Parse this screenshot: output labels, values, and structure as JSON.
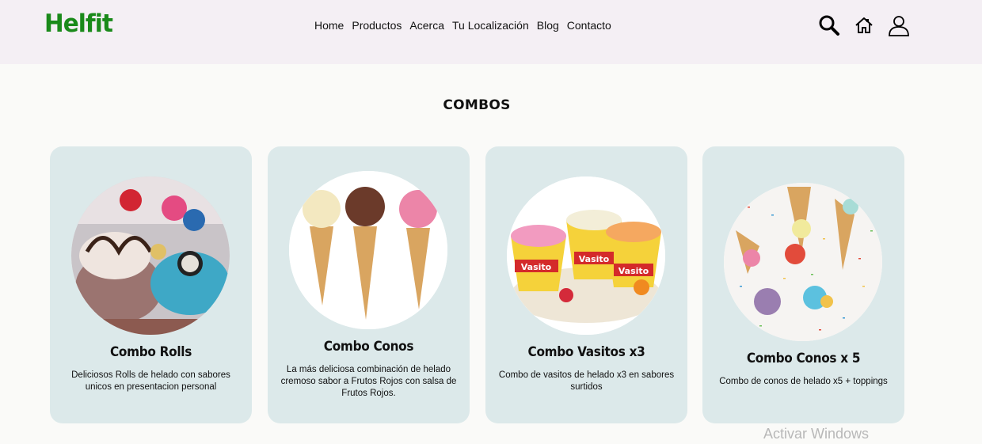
{
  "header": {
    "logo": "Helfit",
    "nav": [
      "Home",
      "Productos",
      "Acerca",
      "Tu Localización",
      "Blog",
      "Contacto"
    ]
  },
  "section": {
    "title": "COMBOS"
  },
  "cards": [
    {
      "name": "Combo Rolls",
      "desc": "Deliciosos Rolls de helado con sabores unicos en presentacion personal"
    },
    {
      "name": "Combo Conos",
      "desc": "La más deliciosa combinación de helado cremoso sabor a Frutos Rojos con salsa de Frutos Rojos."
    },
    {
      "name": "Combo Vasitos x3",
      "desc": "Combo de vasitos de helado x3 en sabores surtidos"
    },
    {
      "name": "Combo Conos x 5",
      "desc": "Combo de conos de helado x5 + toppings"
    }
  ],
  "vasito_label": "Vasito",
  "watermark": "Activar Windows",
  "colors": {
    "brand": "#1a8a1a",
    "header_bg": "#f4eff4",
    "card_bg": "#dce9ea"
  }
}
